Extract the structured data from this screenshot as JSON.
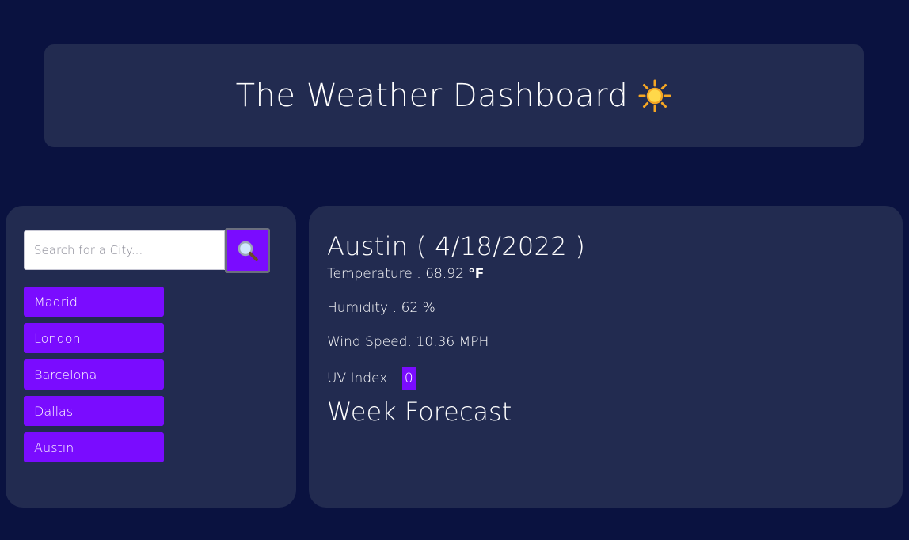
{
  "header": {
    "title": "The Weather Dashboard",
    "icon": "sun-icon"
  },
  "search": {
    "placeholder": "Search for a City...",
    "value": "",
    "button_icon": "search-icon"
  },
  "history": {
    "cities": [
      "Madrid",
      "London",
      "Barcelona",
      "Dallas",
      "Austin"
    ]
  },
  "current": {
    "heading": "Austin ( 4/18/2022 )",
    "temperature_label": "Temperature : 68.92",
    "temperature_unit": "°F",
    "humidity": "Humidity : 62 %",
    "wind": "Wind Speed: 10.36 MPH",
    "uv_label": "UV Index :",
    "uv_value": "0"
  },
  "forecast": {
    "heading": "Week Forecast"
  },
  "colors": {
    "background": "#0a1240",
    "card": "#222b50",
    "accent": "#7a0cff"
  }
}
